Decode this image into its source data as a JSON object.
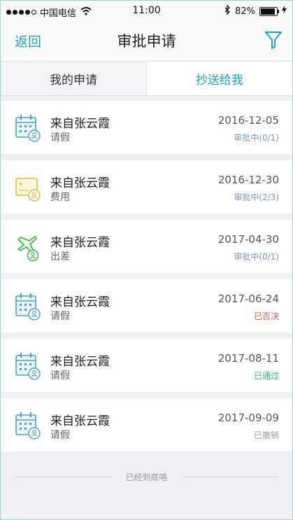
{
  "status_bar": {
    "carrier": "中国电信",
    "time": "11:00",
    "battery": "82%"
  },
  "nav": {
    "back_label": "返回",
    "title": "审批申请",
    "filter_icon": "filter-icon"
  },
  "tabs": [
    {
      "label": "我的申请",
      "active": false
    },
    {
      "label": "抄送给我",
      "active": true
    }
  ],
  "items": [
    {
      "from": "来自张云霞",
      "type": "请假",
      "date": "2016-12-05",
      "status": "审批中(0/1)",
      "status_color": "#7f95b8",
      "icon": "calendar-leave-icon"
    },
    {
      "from": "来自张云霞",
      "type": "费用",
      "date": "2016-12-30",
      "status": "审批中(2/3)",
      "status_color": "#7f95b8",
      "icon": "expense-card-icon"
    },
    {
      "from": "来自张云霞",
      "type": "出差",
      "date": "2017-04-30",
      "status": "审批中(0/1)",
      "status_color": "#7f95b8",
      "icon": "airplane-trip-icon"
    },
    {
      "from": "来自张云霞",
      "type": "请假",
      "date": "2017-06-24",
      "status": "已否决",
      "status_color": "#e0534f",
      "icon": "calendar-leave-icon"
    },
    {
      "from": "来自张云霞",
      "type": "请假",
      "date": "2017-08-11",
      "status": "已通过",
      "status_color": "#2bb67c",
      "icon": "calendar-leave-icon"
    },
    {
      "from": "来自张云霞",
      "type": "请假",
      "date": "2017-09-09",
      "status": "已撤销",
      "status_color": "#999999",
      "icon": "calendar-leave-icon"
    }
  ],
  "footer_text": "已经到底咯",
  "colors": {
    "accent": "#1aa6b7"
  }
}
